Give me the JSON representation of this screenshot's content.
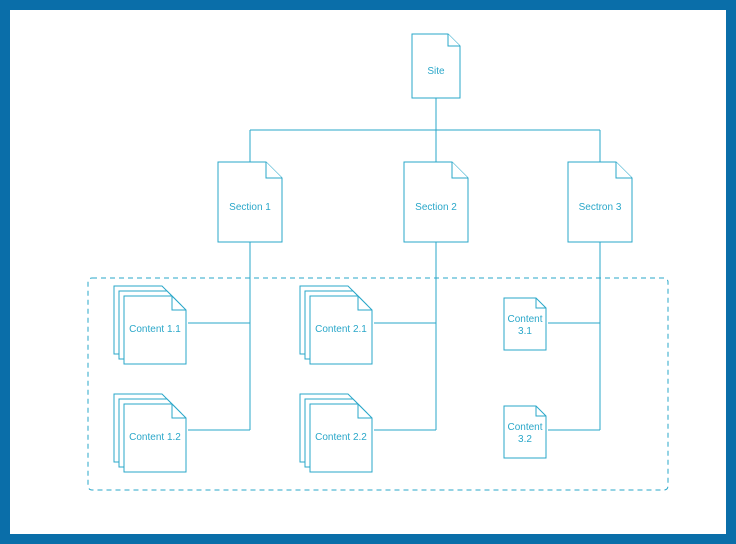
{
  "diagram": {
    "root": {
      "label": "Site"
    },
    "sections": {
      "s1": {
        "label": "Section 1"
      },
      "s2": {
        "label": "Section 2"
      },
      "s3": {
        "label": "Sectron 3"
      }
    },
    "contents": {
      "c11": {
        "label": "Content 1.1"
      },
      "c12": {
        "label": "Content 1.2"
      },
      "c21": {
        "label": "Content 2.1"
      },
      "c22": {
        "label": "Content 2.2"
      },
      "c31": {
        "label": "Content 3.1"
      },
      "c32": {
        "label": "Content 3.2"
      }
    }
  },
  "colors": {
    "border": "#0a6ea9",
    "stroke": "#2aa7c9",
    "dashed": "#2aa7c9"
  },
  "watermark": ""
}
